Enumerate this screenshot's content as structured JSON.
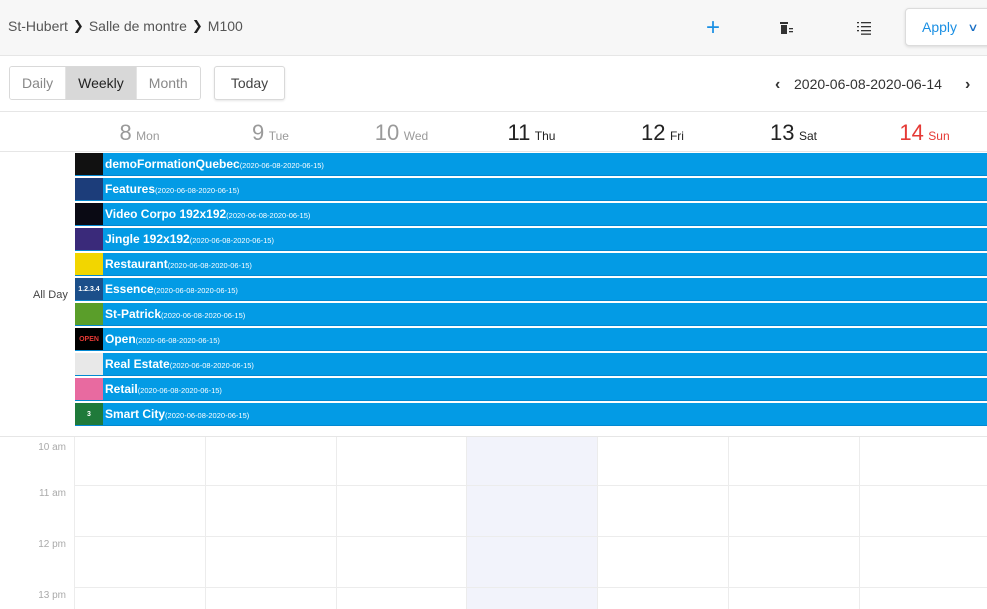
{
  "breadcrumb": [
    "St-Hubert",
    "Salle de montre",
    "M100"
  ],
  "toolbar_top": {
    "add_icon": "plus-icon",
    "trash_icon": "trash-icon",
    "list_icon": "list-icon",
    "apply_label": "Apply"
  },
  "views": {
    "daily": "Daily",
    "weekly": "Weekly",
    "month": "Month",
    "active": "Weekly"
  },
  "today_label": "Today",
  "range_label": "2020-06-08-2020-06-14",
  "days": [
    {
      "num": "8",
      "name": "Mon",
      "state": "past"
    },
    {
      "num": "9",
      "name": "Tue",
      "state": "past"
    },
    {
      "num": "10",
      "name": "Wed",
      "state": "past"
    },
    {
      "num": "11",
      "name": "Thu",
      "state": "current"
    },
    {
      "num": "12",
      "name": "Fri",
      "state": "current"
    },
    {
      "num": "13",
      "name": "Sat",
      "state": "current"
    },
    {
      "num": "14",
      "name": "Sun",
      "state": "sunday"
    }
  ],
  "allday_label": "All Day",
  "events": [
    {
      "title": "demoFormationQuebec",
      "range": "(2020-06-08-2020-06-15)",
      "thumb_color": "#111111",
      "thumb_text": ""
    },
    {
      "title": "Features",
      "range": "(2020-06-08-2020-06-15)",
      "thumb_color": "#1c3d7a",
      "thumb_text": ""
    },
    {
      "title": "Video Corpo 192x192",
      "range": "(2020-06-08-2020-06-15)",
      "thumb_color": "#0a0a14",
      "thumb_text": ""
    },
    {
      "title": "Jingle 192x192",
      "range": "(2020-06-08-2020-06-15)",
      "thumb_color": "#3a2a7a",
      "thumb_text": ""
    },
    {
      "title": "Restaurant",
      "range": "(2020-06-08-2020-06-15)",
      "thumb_color": "#f2d600",
      "thumb_text": ""
    },
    {
      "title": "Essence",
      "range": "(2020-06-08-2020-06-15)",
      "thumb_color": "#1b4f8a",
      "thumb_text": "1.2.3.4"
    },
    {
      "title": "St-Patrick",
      "range": "(2020-06-08-2020-06-15)",
      "thumb_color": "#5a9e2a",
      "thumb_text": ""
    },
    {
      "title": "Open",
      "range": "(2020-06-08-2020-06-15)",
      "thumb_color": "#000000",
      "thumb_text": "OPEN"
    },
    {
      "title": "Real Estate",
      "range": "(2020-06-08-2020-06-15)",
      "thumb_color": "#e8e8e8",
      "thumb_text": ""
    },
    {
      "title": "Retail",
      "range": "(2020-06-08-2020-06-15)",
      "thumb_color": "#e86aa0",
      "thumb_text": ""
    },
    {
      "title": "Smart City",
      "range": "(2020-06-08-2020-06-15)",
      "thumb_color": "#1f7a3a",
      "thumb_text": "3"
    }
  ],
  "times": [
    "10 am",
    "11 am",
    "12 pm",
    "13 pm"
  ],
  "colors": {
    "accent": "#1a8fe3",
    "event": "#039be5",
    "sunday": "#e53935",
    "today_col": "#f2f3fb"
  }
}
